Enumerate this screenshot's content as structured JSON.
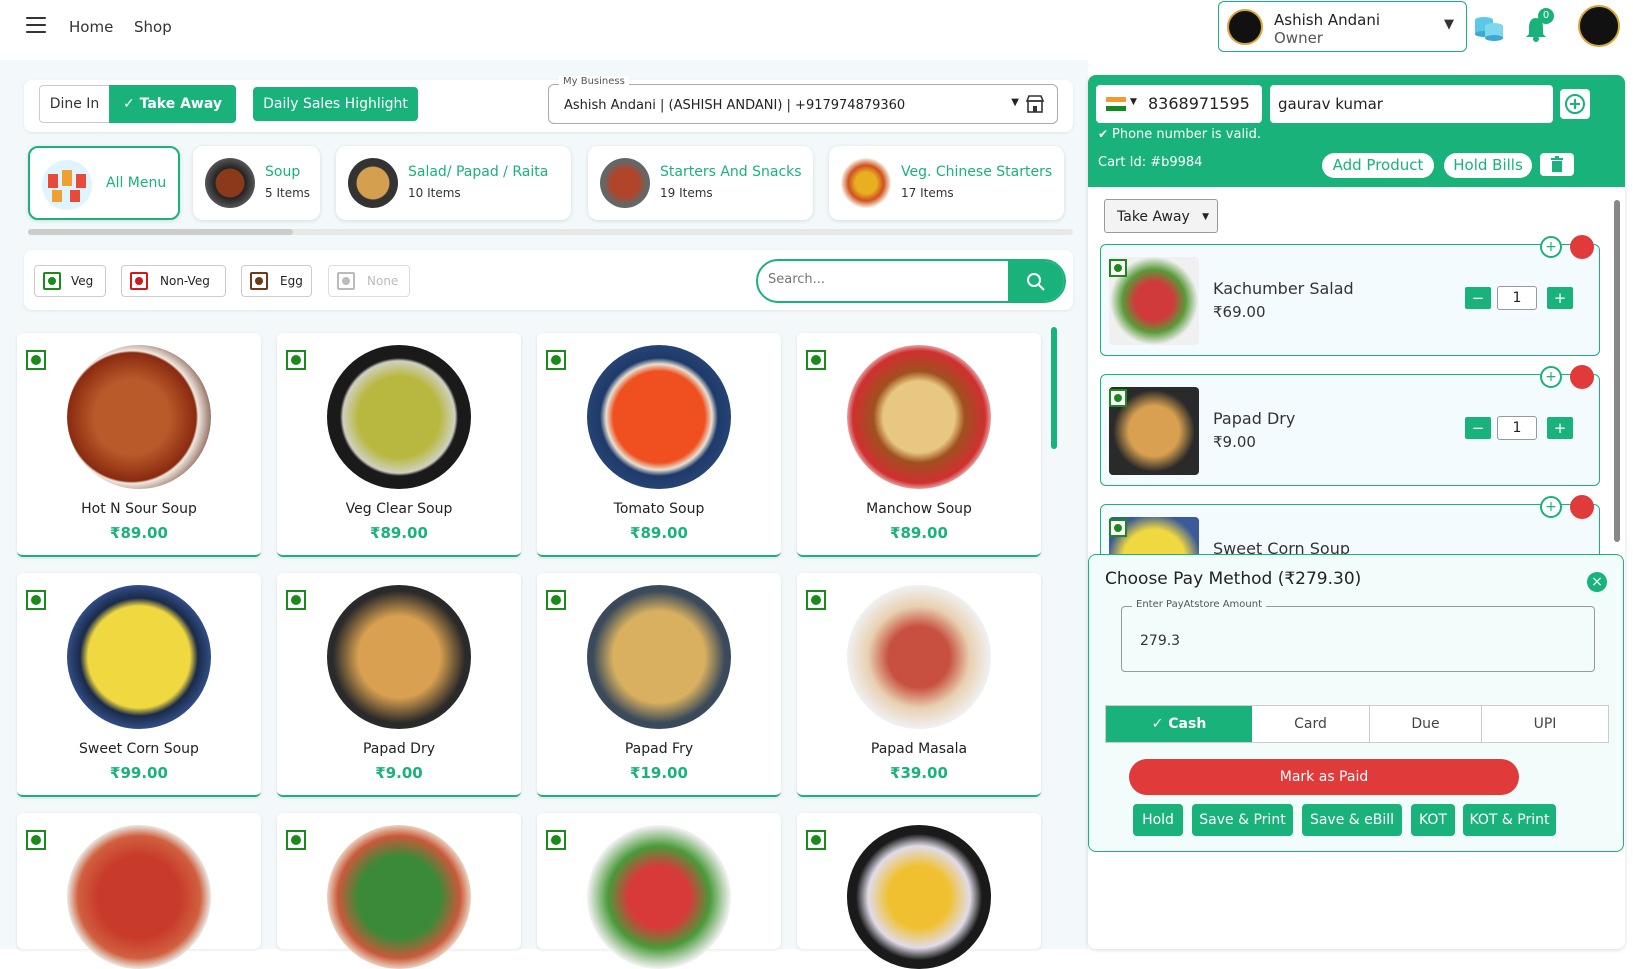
{
  "nav": {
    "home": "Home",
    "shop": "Shop"
  },
  "user": {
    "name": "Ashish Andani",
    "role": "Owner",
    "notifications": "0"
  },
  "order_modes": {
    "dine_in": "Dine In",
    "take_away": "Take Away",
    "daily_sales": "Daily Sales Highlight"
  },
  "business": {
    "label": "My Business",
    "value": "Ashish Andani | (ASHISH ANDANI) | +917974879360"
  },
  "categories": [
    {
      "name": "All Menu",
      "count": ""
    },
    {
      "name": "Soup",
      "count": "5 Items"
    },
    {
      "name": "Salad/ Papad / Raita",
      "count": "10 Items"
    },
    {
      "name": "Starters And Snacks",
      "count": "19 Items"
    },
    {
      "name": "Veg. Chinese Starters",
      "count": "17 Items"
    }
  ],
  "filters": {
    "veg": "Veg",
    "nonveg": "Non-Veg",
    "egg": "Egg",
    "none": "None"
  },
  "search": {
    "placeholder": "Search..."
  },
  "products": [
    {
      "name": "Hot N Sour Soup",
      "price": "₹89.00"
    },
    {
      "name": "Veg Clear Soup",
      "price": "₹89.00"
    },
    {
      "name": "Tomato Soup",
      "price": "₹89.00"
    },
    {
      "name": "Manchow Soup",
      "price": "₹89.00"
    },
    {
      "name": "Sweet Corn Soup",
      "price": "₹99.00"
    },
    {
      "name": "Papad Dry",
      "price": "₹9.00"
    },
    {
      "name": "Papad Fry",
      "price": "₹19.00"
    },
    {
      "name": "Papad Masala",
      "price": "₹39.00"
    }
  ],
  "customer": {
    "phone": "8368971595",
    "name": "gaurav kumar",
    "valid_msg": "Phone number is valid.",
    "cart_id": "Cart Id: #b9984"
  },
  "cart_actions": {
    "add_product": "Add Product",
    "hold_bills": "Hold Bills"
  },
  "order_type": "Take Away",
  "cart_items": [
    {
      "name": "Kachumber Salad",
      "price": "₹69.00",
      "qty": "1"
    },
    {
      "name": "Papad Dry",
      "price": "₹9.00",
      "qty": "1"
    },
    {
      "name": "Sweet Corn Soup",
      "price": "",
      "qty": ""
    }
  ],
  "payment": {
    "title": "Choose Pay Method (₹279.30)",
    "amount_label": "Enter PayAtstore Amount",
    "amount": "279.3",
    "methods": [
      "Cash",
      "Card",
      "Due",
      "UPI"
    ],
    "mark_paid": "Mark as Paid",
    "actions": [
      "Hold",
      "Save & Print",
      "Save & eBill",
      "KOT",
      "KOT & Print"
    ]
  },
  "colors": {
    "accent": "#18b27a",
    "danger": "#e03a3a"
  }
}
